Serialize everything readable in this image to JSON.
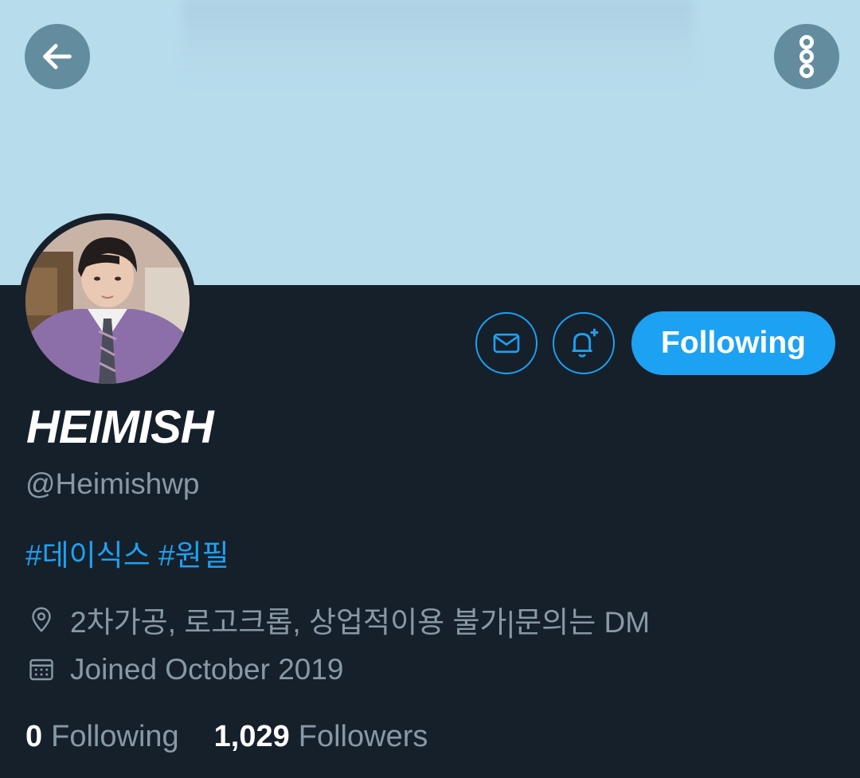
{
  "header": {
    "back_icon": "arrow-left-icon",
    "more_icon": "more-vertical-icon"
  },
  "profile": {
    "display_name": "HEIMISH",
    "handle": "@Heimishwp",
    "bio_tags": [
      "#데이식스",
      "#원필"
    ],
    "location": "2차가공, 로고크롭, 상업적이용 불가|문의는 DM",
    "joined": "Joined October 2019"
  },
  "actions": {
    "message_icon": "mail-icon",
    "notify_icon": "bell-plus-icon",
    "follow_label": "Following"
  },
  "stats": {
    "following_count": "0",
    "following_label": "Following",
    "followers_count": "1,029",
    "followers_label": "Followers"
  },
  "colors": {
    "accent": "#1da1f2",
    "background": "#15202b",
    "banner": "#b7dcec",
    "muted_text": "#8899a6"
  }
}
